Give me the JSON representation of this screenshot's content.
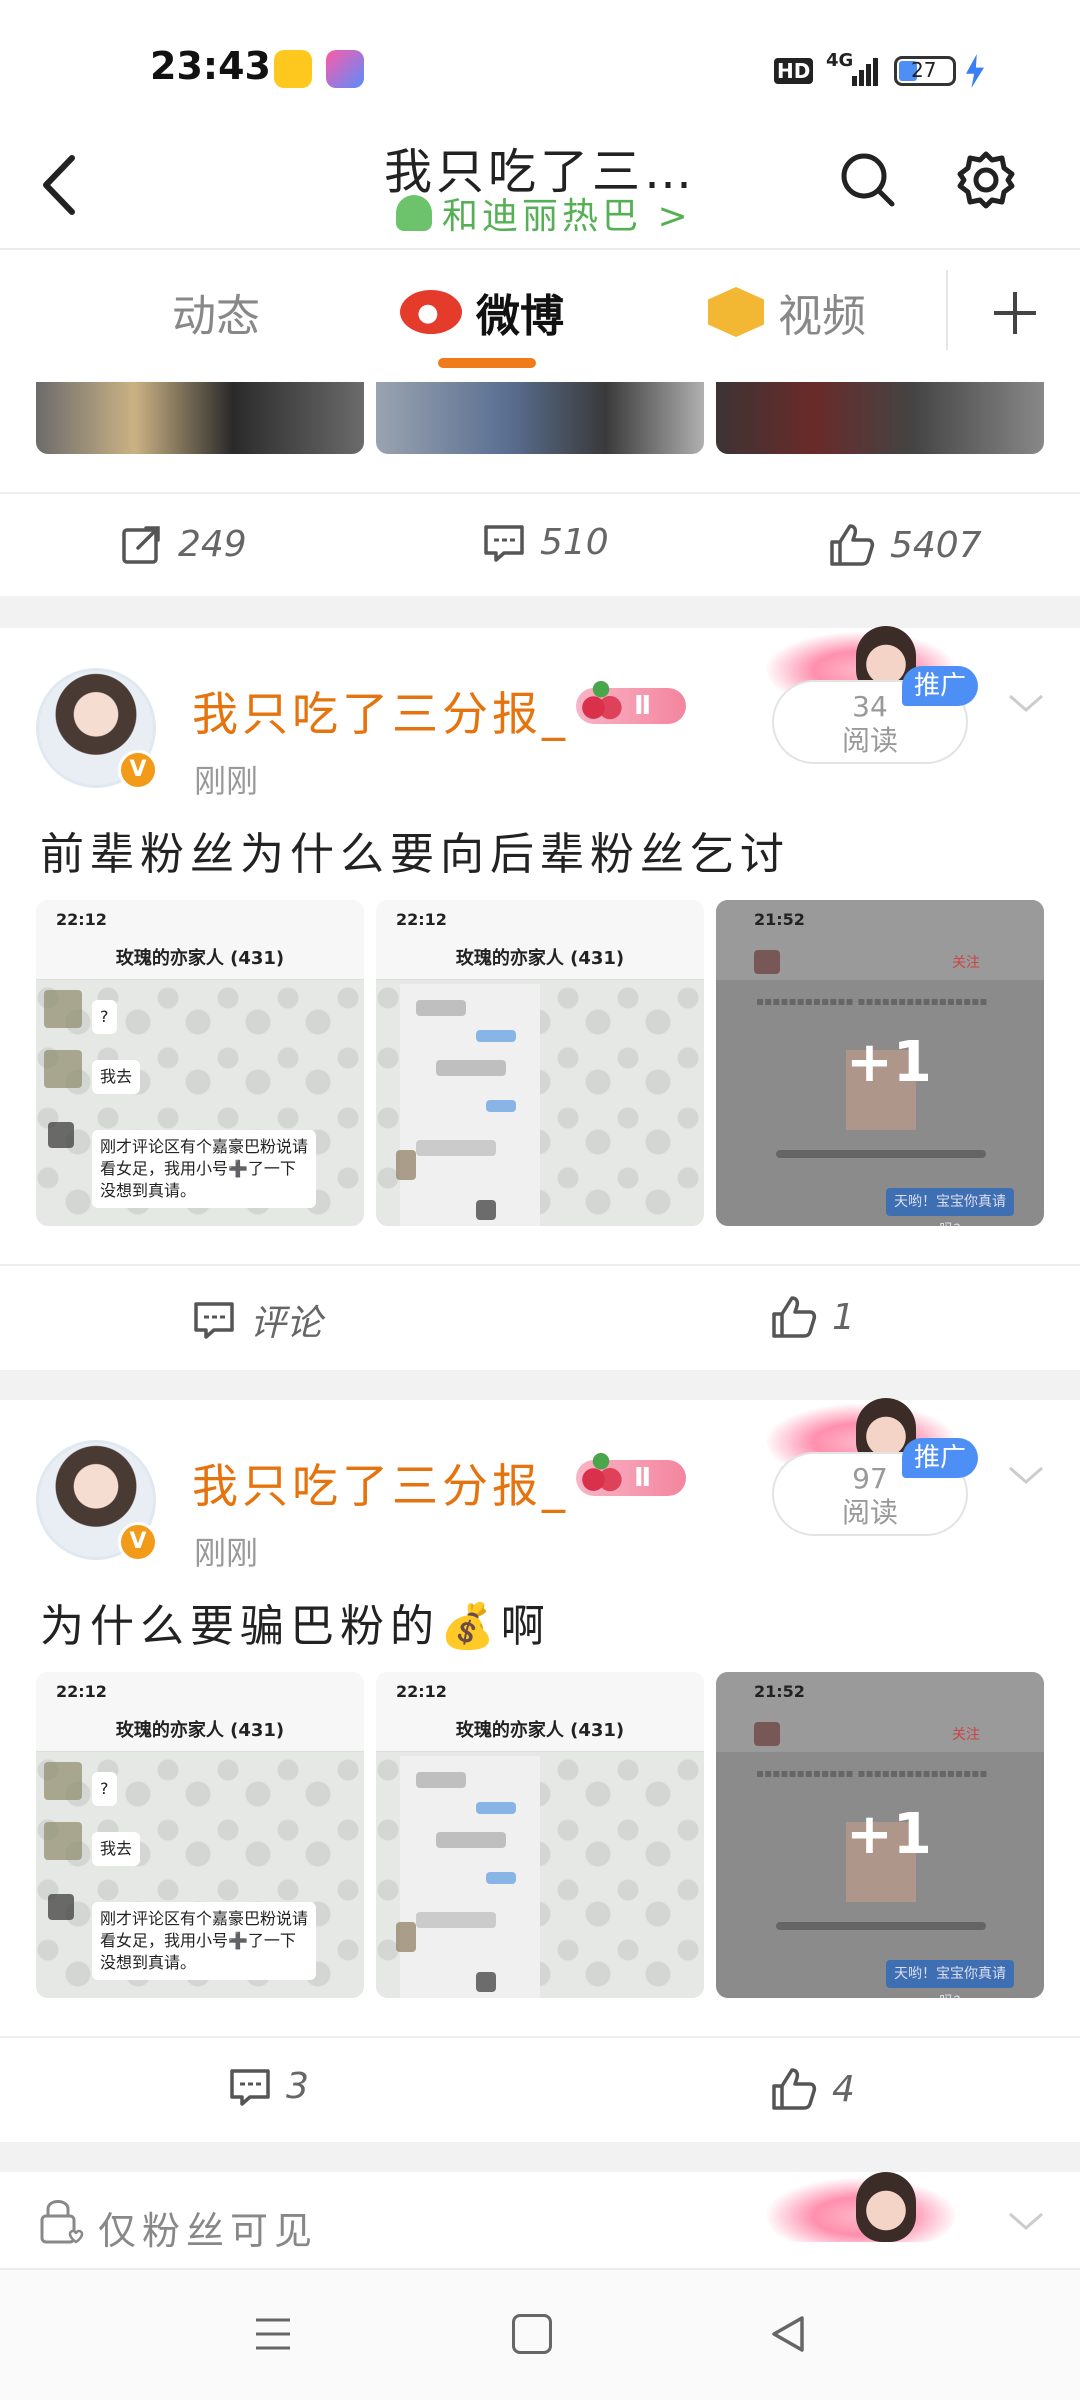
{
  "status_bar": {
    "time": "23:43",
    "hd": "HD",
    "network": "4G",
    "battery": "27"
  },
  "header": {
    "title": "我只吃了三…",
    "subtitle": "和迪丽热巴 >"
  },
  "tabs": [
    {
      "label": "动态",
      "icon": "dynamics-tab"
    },
    {
      "label": "微博",
      "icon": "weibo-logo-icon",
      "active": true
    },
    {
      "label": "视频",
      "icon": "video-play-icon"
    }
  ],
  "top_actions": {
    "share": "249",
    "comment": "510",
    "like": "5407"
  },
  "posts": [
    {
      "username": "我只吃了三分报_",
      "level": "Ⅱ",
      "time": "刚刚",
      "reads_count": "34",
      "reads_label": "阅读",
      "promo": "推广",
      "text": "前辈粉丝为什么要向后辈粉丝乞讨",
      "comment_label": "评论",
      "like": "1"
    },
    {
      "username": "我只吃了三分报_",
      "level": "Ⅱ",
      "time": "刚刚",
      "reads_count": "97",
      "reads_label": "阅读",
      "promo": "推广",
      "text": "为什么要骗巴粉的💰啊",
      "comment_label": "3",
      "like": "4"
    }
  ],
  "images": {
    "chat": {
      "status_time": "22:12",
      "title": "玫瑰的亦家人 (431)",
      "q": "?",
      "reply": "我去",
      "long_msg": "刚才评论区有个嘉豪巴粉说请看女足，我用小号➕了一下没想到真请。"
    },
    "dark": {
      "status_time": "21:52",
      "follow": "关注",
      "overlay": "+1",
      "button": "天哟！宝宝你真请吗?"
    }
  },
  "footer_post": {
    "label": "仅粉丝可见"
  },
  "colors": {
    "accent": "#f07b1a",
    "username": "#e5740e",
    "promo": "#4d8ff5"
  }
}
